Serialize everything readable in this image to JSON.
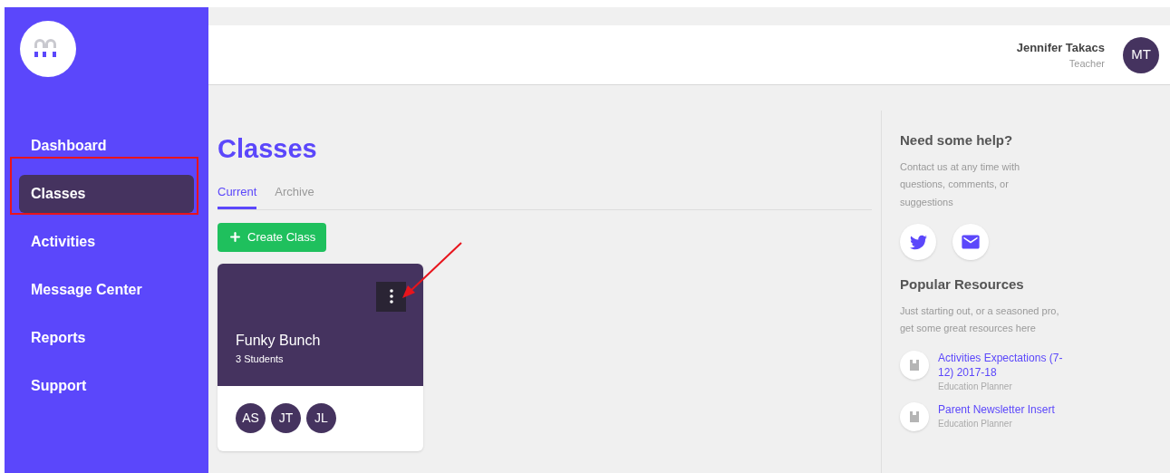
{
  "sidebar": {
    "items": [
      {
        "label": "Dashboard",
        "selected": false
      },
      {
        "label": "Classes",
        "selected": true
      },
      {
        "label": "Activities",
        "selected": false
      },
      {
        "label": "Message Center",
        "selected": false
      },
      {
        "label": "Reports",
        "selected": false
      },
      {
        "label": "Support",
        "selected": false
      }
    ]
  },
  "header": {
    "user_name": "Jennifer Takacs",
    "user_role": "Teacher",
    "avatar_initials": "MT"
  },
  "page_title": "Classes",
  "tabs": [
    {
      "label": "Current",
      "selected": true
    },
    {
      "label": "Archive",
      "selected": false
    }
  ],
  "create_button": "Create Class",
  "classes": [
    {
      "name": "Funky Bunch",
      "count": "3 Students",
      "students": [
        "AS",
        "JT",
        "JL"
      ]
    }
  ],
  "help": {
    "title": "Need some help?",
    "text": "Contact us at any time with questions, comments, or suggestions"
  },
  "resources": {
    "title": "Popular Resources",
    "text": "Just starting out, or a seasoned pro, get some great resources here",
    "items": [
      {
        "title": "Activities Expectations (7-12) 2017-18",
        "source": "Education Planner"
      },
      {
        "title": "Parent Newsletter Insert",
        "source": "Education Planner"
      }
    ]
  }
}
